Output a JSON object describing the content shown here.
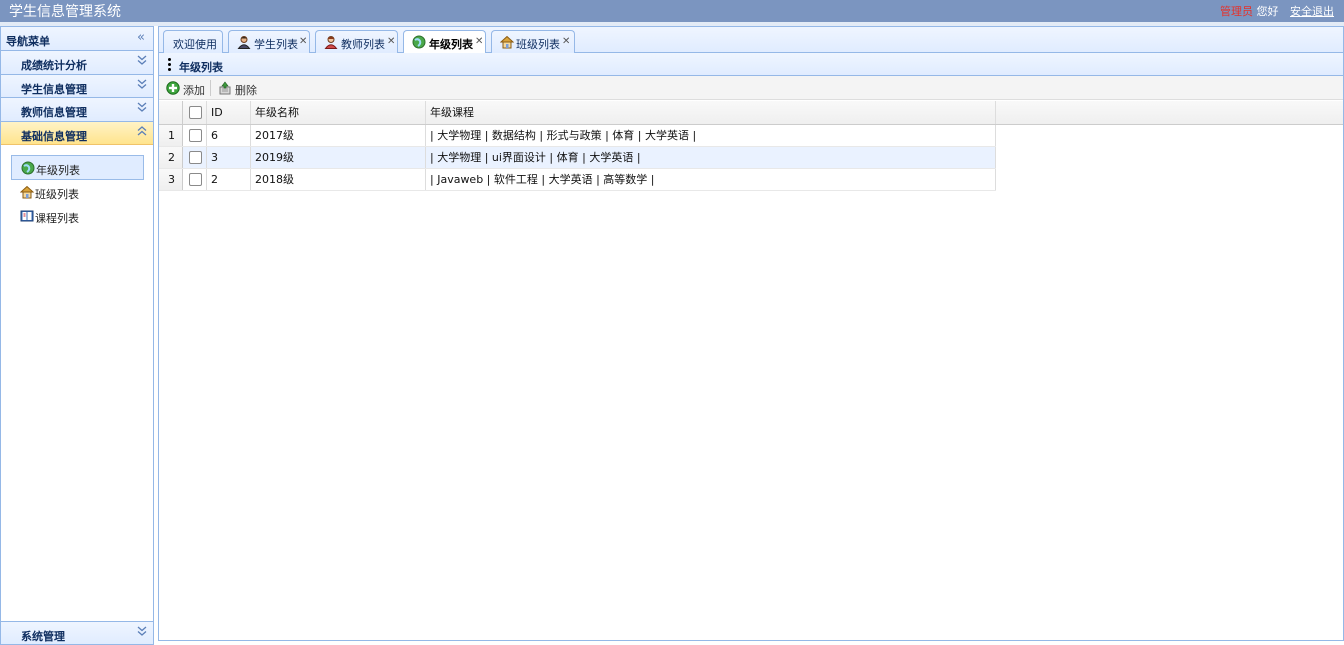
{
  "app": {
    "title": "学生信息管理系统",
    "role": "管理员",
    "greeting": "您好",
    "logout": "安全退出"
  },
  "sidebar": {
    "title": "导航菜单",
    "sections": [
      {
        "label": "成绩统计分析"
      },
      {
        "label": "学生信息管理"
      },
      {
        "label": "教师信息管理"
      },
      {
        "label": "基础信息管理"
      }
    ],
    "items": [
      {
        "label": "年级列表"
      },
      {
        "label": "班级列表"
      },
      {
        "label": "课程列表"
      }
    ],
    "bottom": {
      "label": "系统管理"
    }
  },
  "tabs": [
    {
      "label": "欢迎使用"
    },
    {
      "label": "学生列表"
    },
    {
      "label": "教师列表"
    },
    {
      "label": "年级列表"
    },
    {
      "label": "班级列表"
    }
  ],
  "panel": {
    "title": "年级列表",
    "toolbar": {
      "add": "添加",
      "delete": "删除"
    }
  },
  "grid": {
    "columns": {
      "id": "ID",
      "name": "年级名称",
      "courses": "年级课程"
    },
    "rows": [
      {
        "num": "1",
        "id": "6",
        "name": "2017级",
        "courses": "| 大学物理 | 数据结构 | 形式与政策 | 体育 | 大学英语 |"
      },
      {
        "num": "2",
        "id": "3",
        "name": "2019级",
        "courses": "| 大学物理 | ui界面设计 | 体育 | 大学英语 |"
      },
      {
        "num": "3",
        "id": "2",
        "name": "2018级",
        "courses": "| Javaweb | 软件工程 | 大学英语 | 高等数学 |"
      }
    ]
  },
  "colors": {
    "header": "#7b95c0",
    "border": "#95b8e7",
    "active_section": "#ffe48d",
    "role_text": "#e4322b"
  }
}
